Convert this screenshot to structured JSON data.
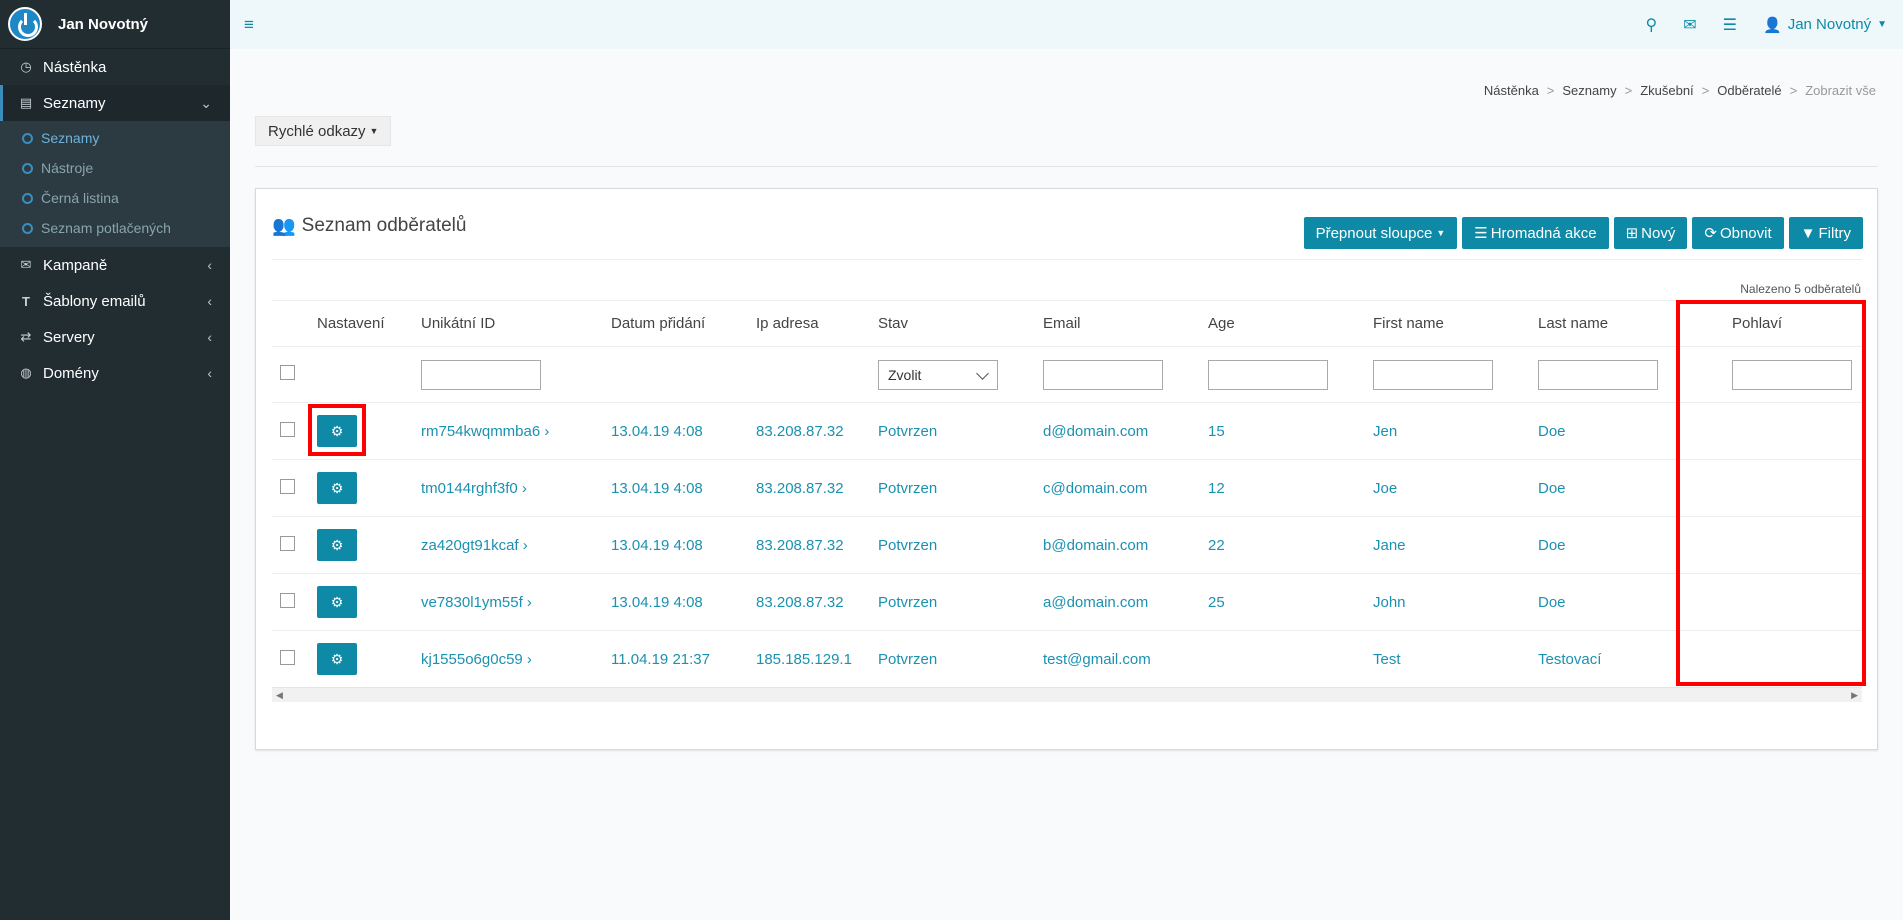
{
  "brand": {
    "name": "Jan Novotný"
  },
  "sidebar": {
    "items": [
      {
        "label": "Nástěnka",
        "icon": "dashboard-icon"
      },
      {
        "label": "Seznamy",
        "icon": "list-icon"
      },
      {
        "label": "Kampaně",
        "icon": "envelope-icon"
      },
      {
        "label": "Šablony emailů",
        "icon": "text-icon"
      },
      {
        "label": "Servery",
        "icon": "exchange-icon"
      },
      {
        "label": "Domény",
        "icon": "globe-icon"
      }
    ],
    "sub": [
      "Seznamy",
      "Nástroje",
      "Černá listina",
      "Seznam potlačených"
    ]
  },
  "topbar": {
    "user": "Jan Novotný"
  },
  "breadcrumb": [
    "Nástěnka",
    "Seznamy",
    "Zkušební",
    "Odběratelé",
    "Zobrazit vše"
  ],
  "quick_links": "Rychlé odkazy",
  "box": {
    "title": "Seznam odběratelů",
    "actions": [
      "Přepnout sloupce",
      "Hromadná akce",
      "Nový",
      "Obnovit",
      "Filtry"
    ],
    "found": "Nalezeno 5 odběratelů"
  },
  "table": {
    "headers": [
      "Nastavení",
      "Unikátní ID",
      "Datum přidání",
      "Ip adresa",
      "Stav",
      "Email",
      "Age",
      "First name",
      "Last name",
      "Pohlaví"
    ],
    "filter_select": "Zvolit",
    "rows": [
      {
        "id": "rm754kwqmmba6 ›",
        "date": "13.04.19 4:08",
        "ip": "83.208.87.32",
        "status": "Potvrzen",
        "email": "d@domain.com",
        "age": "15",
        "first": "Jen",
        "last": "Doe",
        "gender": ""
      },
      {
        "id": "tm0144rghf3f0 ›",
        "date": "13.04.19 4:08",
        "ip": "83.208.87.32",
        "status": "Potvrzen",
        "email": "c@domain.com",
        "age": "12",
        "first": "Joe",
        "last": "Doe",
        "gender": ""
      },
      {
        "id": "za420gt91kcaf ›",
        "date": "13.04.19 4:08",
        "ip": "83.208.87.32",
        "status": "Potvrzen",
        "email": "b@domain.com",
        "age": "22",
        "first": "Jane",
        "last": "Doe",
        "gender": ""
      },
      {
        "id": "ve7830l1ym55f ›",
        "date": "13.04.19 4:08",
        "ip": "83.208.87.32",
        "status": "Potvrzen",
        "email": "a@domain.com",
        "age": "25",
        "first": "John",
        "last": "Doe",
        "gender": ""
      },
      {
        "id": "kj1555o6g0c59 ›",
        "date": "11.04.19 21:37",
        "ip": "185.185.129.1",
        "status": "Potvrzen",
        "email": "test@gmail.com",
        "age": "",
        "first": "Test",
        "last": "Testovací",
        "gender": ""
      }
    ]
  },
  "colors": {
    "accent": "#0e8aa6",
    "sidebar": "#222d32",
    "highlight": "#ff0000"
  }
}
